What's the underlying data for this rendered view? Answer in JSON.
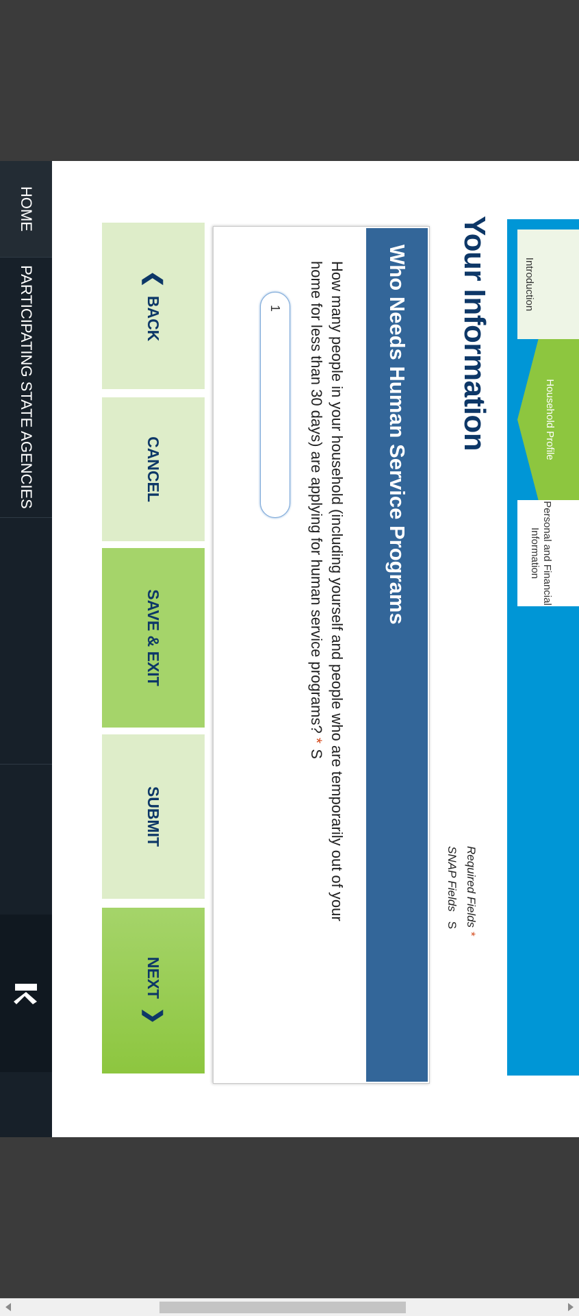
{
  "nav": {
    "home": "HOME",
    "agencies": "PARTICIPATING STATE AGENCIES",
    "logo": "logo-mark-icon"
  },
  "page": {
    "title": "Your Information",
    "required_fields": "Required Fields",
    "required_star": "*",
    "snap_fields": "SNAP Fields",
    "snap_mark": "S"
  },
  "progress": {
    "steps": [
      {
        "label": "Introduction",
        "state": "completed"
      },
      {
        "label": "Household Profile",
        "state": "current"
      },
      {
        "label": "Personal and Financial Information",
        "state": "upcoming"
      }
    ],
    "color_bar": "#0096d6",
    "color_current": "#8dc63f"
  },
  "section": {
    "title": "Who Needs Human Service Programs",
    "question": "How many people in your household (including yourself and people who are temporarily out of your home for less than 30 days) are applying for human service programs?",
    "question_star": "*",
    "question_snap": "S",
    "answer_value": "1"
  },
  "buttons": {
    "back": "BACK",
    "cancel": "CANCEL",
    "save_exit": "SAVE & EXIT",
    "submit": "SUBMIT",
    "next": "NEXT"
  }
}
